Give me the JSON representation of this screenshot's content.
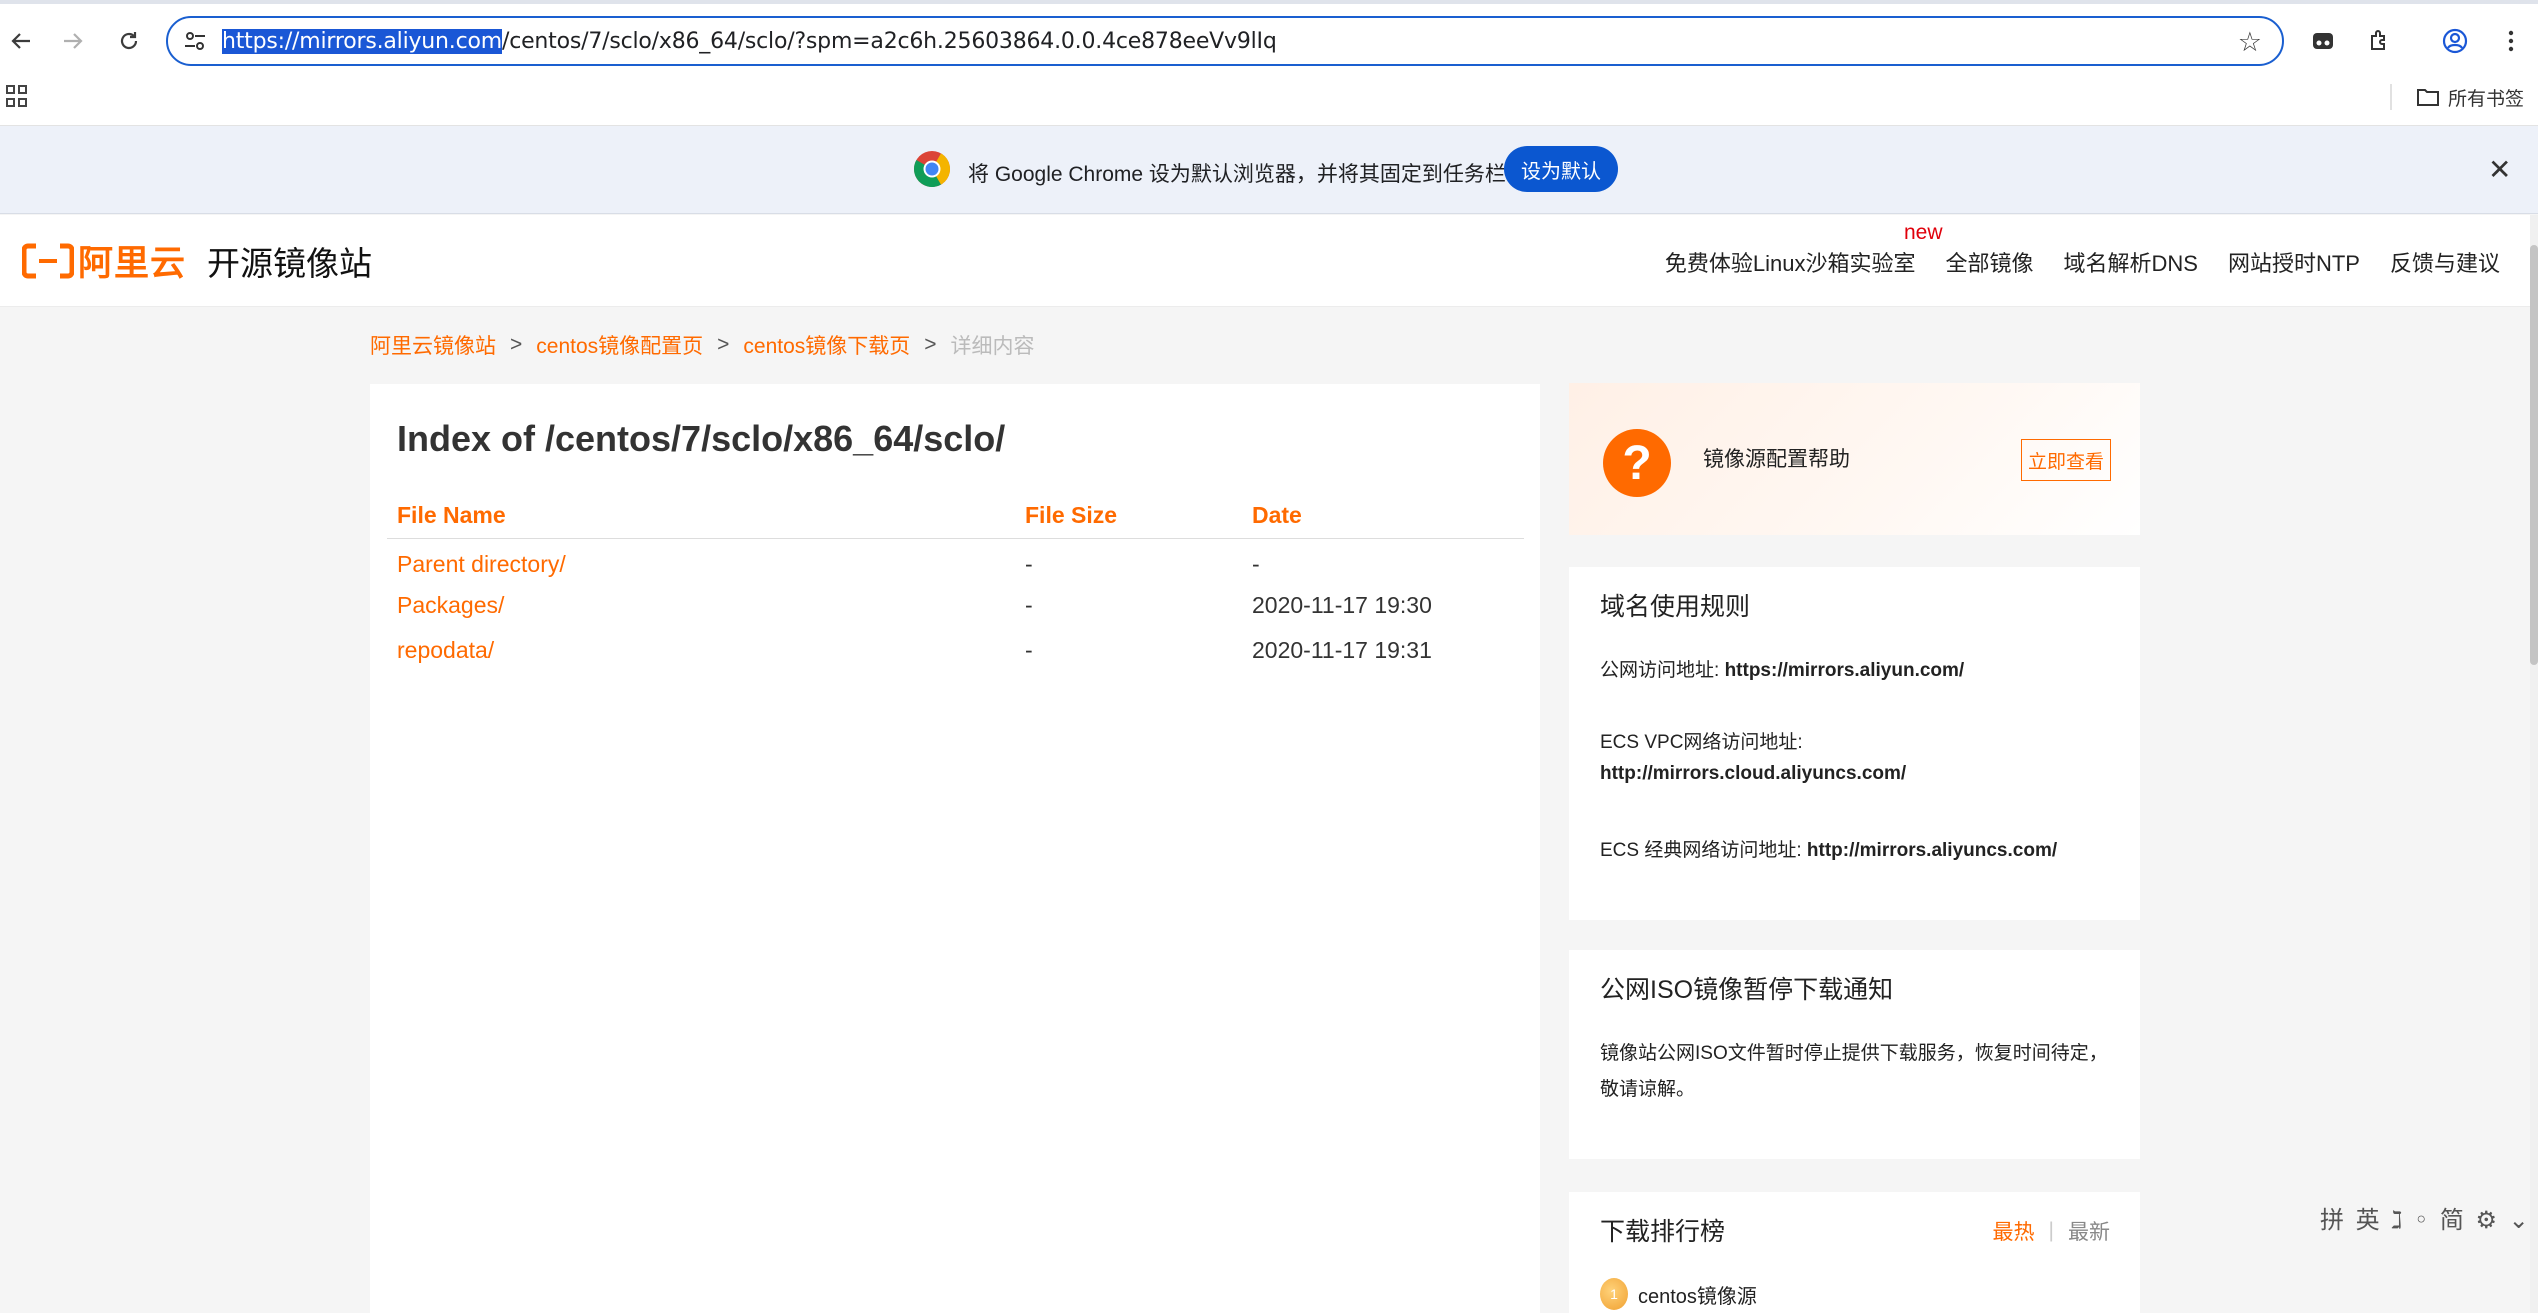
{
  "browser": {
    "url_highlighted": "https://mirrors.aliyun.com",
    "url_rest": "/centos/7/sclo/x86_64/sclo/?spm=a2c6h.25603864.0.0.4ce878eeVv9lIq",
    "all_bookmarks_label": "所有书签",
    "infobar_text": "将 Google Chrome 设为默认浏览器，并将其固定到任务栏",
    "infobar_button": "设为默认",
    "infobar_close": "✕"
  },
  "site": {
    "logo_text": "阿里云",
    "title": "开源镜像站",
    "nav": {
      "sandbox": "免费体验Linux沙箱实验室",
      "new_badge": "new",
      "all_mirrors": "全部镜像",
      "dns": "域名解析DNS",
      "ntp": "网站授时NTP",
      "feedback": "反馈与建议"
    }
  },
  "breadcrumb": {
    "home": "阿里云镜像站",
    "config": "centos镜像配置页",
    "download": "centos镜像下载页",
    "current": "详细内容",
    "sep": ">"
  },
  "index": {
    "title": "Index of /centos/7/sclo/x86_64/sclo/",
    "columns": {
      "name": "File Name",
      "size": "File Size",
      "date": "Date"
    },
    "rows": [
      {
        "name": "Parent directory/",
        "size": "-",
        "date": "-"
      },
      {
        "name": "Packages/",
        "size": "-",
        "date": "2020-11-17 19:30"
      },
      {
        "name": "repodata/",
        "size": "-",
        "date": "2020-11-17 19:31"
      }
    ]
  },
  "help": {
    "icon": "?",
    "text": "镜像源配置帮助",
    "button": "立即查看"
  },
  "rules": {
    "title": "域名使用规则",
    "public_label": "公网访问地址: ",
    "public_url": "https://mirrors.aliyun.com/",
    "vpc_label": "ECS VPC网络访问地址:",
    "vpc_url": "http://mirrors.cloud.aliyuncs.com/",
    "classic_label": "ECS 经典网络访问地址: ",
    "classic_url": "http://mirrors.aliyuncs.com/"
  },
  "iso_notice": {
    "title": "公网ISO镜像暂停下载通知",
    "text": "镜像站公网ISO文件暂时停止提供下载服务，恢复时间待定，敬请谅解。"
  },
  "ranking": {
    "title": "下载排行榜",
    "hot": "最热",
    "divider": "|",
    "newest": "最新",
    "items": [
      {
        "rank": "1",
        "name": "centos镜像源"
      }
    ]
  },
  "ime": {
    "text": "拼 英 ℷ ◦ 简 ⚙ ⌄"
  },
  "colors": {
    "accent": "#ff6a00",
    "chrome_blue": "#0b57d0",
    "selection": "#1a57d6"
  }
}
